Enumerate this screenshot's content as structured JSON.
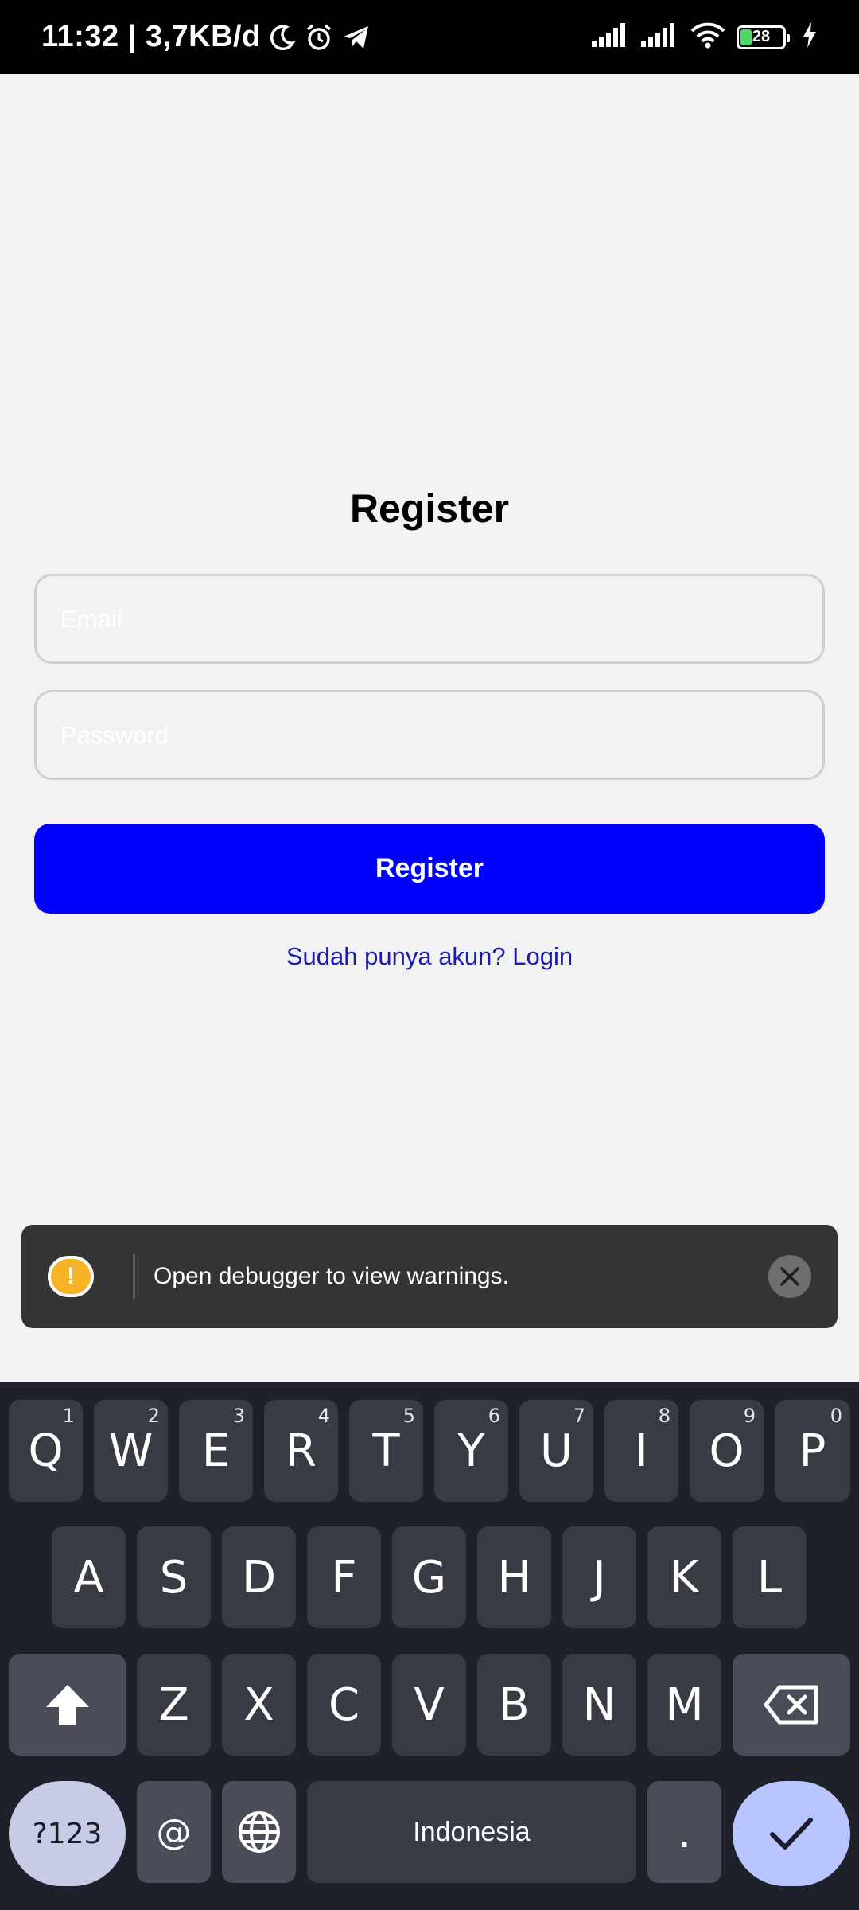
{
  "status_bar": {
    "time_speed": "11:32 | 3,7KB/d",
    "battery": "28",
    "icons": [
      "moon-icon",
      "alarm-icon",
      "telegram-icon",
      "signal-icon",
      "signal-icon",
      "wifi-icon",
      "battery-icon",
      "charging-icon"
    ]
  },
  "form": {
    "title": "Register",
    "email_placeholder": "Email",
    "password_placeholder": "Password",
    "register_label": "Register",
    "login_link": "Sudah punya akun? Login"
  },
  "toast": {
    "message": "Open debugger to view warnings.",
    "icon": "!"
  },
  "keyboard": {
    "row1": [
      {
        "k": "Q",
        "h": "1"
      },
      {
        "k": "W",
        "h": "2"
      },
      {
        "k": "E",
        "h": "3"
      },
      {
        "k": "R",
        "h": "4"
      },
      {
        "k": "T",
        "h": "5"
      },
      {
        "k": "Y",
        "h": "6"
      },
      {
        "k": "U",
        "h": "7"
      },
      {
        "k": "I",
        "h": "8"
      },
      {
        "k": "O",
        "h": "9"
      },
      {
        "k": "P",
        "h": "0"
      }
    ],
    "row2": [
      "A",
      "S",
      "D",
      "F",
      "G",
      "H",
      "J",
      "K",
      "L"
    ],
    "row3": [
      "Z",
      "X",
      "C",
      "V",
      "B",
      "N",
      "M"
    ],
    "symbols_label": "?123",
    "at_label": "@",
    "space_label": "Indonesia",
    "period_label": "."
  },
  "colors": {
    "primary_button": "#0000ff",
    "link": "#1a1ab0",
    "toast_bg": "#343434",
    "warning": "#f5b325",
    "keyboard_bg": "#1e2129",
    "enter_key": "#b9c5ff"
  }
}
